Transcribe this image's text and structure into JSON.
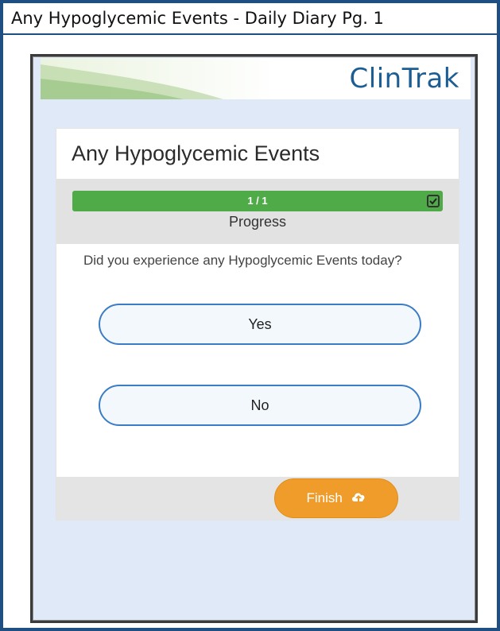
{
  "page_title": "Any Hypoglycemic Events - Daily Diary Pg. 1",
  "brand": "ClinTrak",
  "card": {
    "title": "Any Hypoglycemic Events",
    "progress": {
      "text": "1 / 1",
      "value": 1.0,
      "label": "Progress"
    },
    "question": "Did you experience any Hypoglycemic Events today?",
    "answers": [
      "Yes",
      "No"
    ],
    "finish_label": "Finish"
  },
  "icons": {
    "progress_complete": "check-square-icon",
    "finish": "cloud-upload-icon"
  },
  "colors": {
    "frame_border": "#1f4f82",
    "brand_text": "#1c5e94",
    "progress_fill": "#4faa48",
    "answer_border": "#3a7cc6",
    "finish_button": "#ef9c2b",
    "device_background": "#dfe9f7"
  }
}
